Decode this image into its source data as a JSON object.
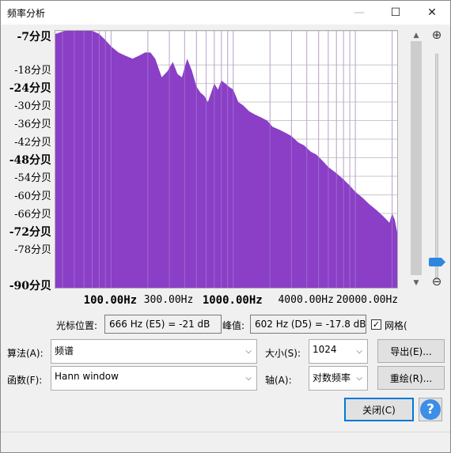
{
  "window": {
    "title": "频率分析",
    "minimize_glyph": "—",
    "maximize_glyph": "☐",
    "close_glyph": "✕"
  },
  "y_axis": {
    "labels": [
      {
        "text": "-7分贝",
        "value": -7,
        "major": true
      },
      {
        "text": "-18分贝",
        "value": -18,
        "major": false
      },
      {
        "text": "-24分贝",
        "value": -24,
        "major": true
      },
      {
        "text": "-30分贝",
        "value": -30,
        "major": false
      },
      {
        "text": "-36分贝",
        "value": -36,
        "major": false
      },
      {
        "text": "-42分贝",
        "value": -42,
        "major": false
      },
      {
        "text": "-48分贝",
        "value": -48,
        "major": true
      },
      {
        "text": "-54分贝",
        "value": -54,
        "major": false
      },
      {
        "text": "-60分贝",
        "value": -60,
        "major": false
      },
      {
        "text": "-66分贝",
        "value": -66,
        "major": false
      },
      {
        "text": "-72分贝",
        "value": -72,
        "major": true
      },
      {
        "text": "-78分贝",
        "value": -78,
        "major": false
      },
      {
        "text": "-90分贝",
        "value": -90,
        "major": true
      }
    ]
  },
  "x_axis": {
    "labels": [
      {
        "text": "100.00Hz",
        "hz": 100,
        "major": true
      },
      {
        "text": "300.00Hz",
        "hz": 300,
        "major": false
      },
      {
        "text": "1000.00Hz",
        "hz": 1000,
        "major": true
      },
      {
        "text": "4000.00Hz",
        "hz": 4000,
        "major": false
      },
      {
        "text": "20000.00Hz",
        "hz": 20000,
        "major": false
      }
    ]
  },
  "chart_data": {
    "type": "area",
    "x_scale": "log",
    "fill_color": "#8a3fc6",
    "grid": true,
    "xlim": [
      35,
      22000
    ],
    "ylim": [
      -90,
      -7
    ],
    "x": [
      35,
      42,
      50,
      60,
      70,
      80,
      90,
      100,
      115,
      130,
      150,
      170,
      190,
      210,
      230,
      260,
      290,
      320,
      350,
      380,
      420,
      460,
      500,
      540,
      580,
      620,
      660,
      700,
      750,
      800,
      860,
      920,
      1000,
      1100,
      1200,
      1350,
      1500,
      1700,
      1900,
      2100,
      2400,
      2700,
      3000,
      3400,
      3800,
      4300,
      4800,
      5400,
      6000,
      7000,
      8000,
      9000,
      10000,
      11500,
      13000,
      15000,
      17000,
      19000,
      20000,
      21000,
      22000
    ],
    "y": [
      -8,
      -7,
      -7,
      -7,
      -7,
      -8,
      -10,
      -12,
      -14,
      -15,
      -16,
      -15,
      -14,
      -14,
      -16,
      -22,
      -20,
      -17,
      -21,
      -22,
      -16,
      -20,
      -25,
      -27,
      -28,
      -30,
      -27,
      -24,
      -26,
      -23,
      -24,
      -25,
      -26,
      -30,
      -31,
      -33,
      -34,
      -35,
      -36,
      -38,
      -39,
      -40,
      -41,
      -43,
      -44,
      -46,
      -47,
      -49,
      -51,
      -53,
      -55,
      -57,
      -59,
      -61,
      -63,
      -65,
      -67,
      -69,
      -66,
      -68,
      -72
    ]
  },
  "cursor": {
    "label": "光标位置:",
    "value": "666 Hz (E5) = -21 dB"
  },
  "peak": {
    "label": "峰值:",
    "value": "602 Hz (D5) = -17.8 dB"
  },
  "grid_toggle": {
    "label": "网格(",
    "checked": true,
    "check_glyph": "✓"
  },
  "algorithm": {
    "label": "算法(A):",
    "value": "频谱"
  },
  "size": {
    "label": "大小(S):",
    "value": "1024"
  },
  "function": {
    "label": "函数(F):",
    "value": "Hann window"
  },
  "axis": {
    "label": "轴(A):",
    "value": "对数频率"
  },
  "buttons": {
    "export": "导出(E)...",
    "replot": "重绘(R)...",
    "close": "关闭(C)",
    "help": "?"
  },
  "icons": {
    "zoom_in": "⊕",
    "zoom_out": "⊖",
    "scroll_up": "▲",
    "scroll_down": "▼",
    "dropdown": "⌵"
  }
}
